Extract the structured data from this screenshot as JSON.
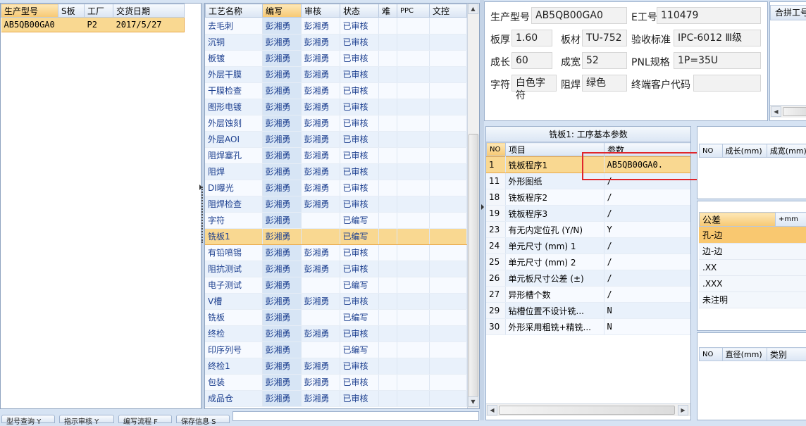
{
  "left_grid": {
    "headers": [
      "生产型号",
      "S板",
      "工厂",
      "交货日期"
    ],
    "rows": [
      {
        "model": "AB5QB00GA0",
        "s_board": "",
        "factory": "P2",
        "date": "2017/5/27"
      }
    ]
  },
  "process_grid": {
    "headers": [
      "工艺名称",
      "编写",
      "审核",
      "状态",
      "难",
      "PPC",
      "文控"
    ],
    "rows": [
      {
        "name": "去毛刺",
        "writer": "彭湘勇",
        "reviewer": "彭湘勇",
        "status": "已审核"
      },
      {
        "name": "沉铜",
        "writer": "彭湘勇",
        "reviewer": "彭湘勇",
        "status": "已审核"
      },
      {
        "name": "板镀",
        "writer": "彭湘勇",
        "reviewer": "彭湘勇",
        "status": "已审核"
      },
      {
        "name": "外层干膜",
        "writer": "彭湘勇",
        "reviewer": "彭湘勇",
        "status": "已审核"
      },
      {
        "name": "干膜检查",
        "writer": "彭湘勇",
        "reviewer": "彭湘勇",
        "status": "已审核"
      },
      {
        "name": "图形电镀",
        "writer": "彭湘勇",
        "reviewer": "彭湘勇",
        "status": "已审核"
      },
      {
        "name": "外层蚀刻",
        "writer": "彭湘勇",
        "reviewer": "彭湘勇",
        "status": "已审核"
      },
      {
        "name": "外层AOI",
        "writer": "彭湘勇",
        "reviewer": "彭湘勇",
        "status": "已审核"
      },
      {
        "name": "阻焊塞孔",
        "writer": "彭湘勇",
        "reviewer": "彭湘勇",
        "status": "已审核"
      },
      {
        "name": "阻焊",
        "writer": "彭湘勇",
        "reviewer": "彭湘勇",
        "status": "已审核"
      },
      {
        "name": "DI曝光",
        "writer": "彭湘勇",
        "reviewer": "彭湘勇",
        "status": "已审核"
      },
      {
        "name": "阻焊检查",
        "writer": "彭湘勇",
        "reviewer": "彭湘勇",
        "status": "已审核"
      },
      {
        "name": "字符",
        "writer": "彭湘勇",
        "reviewer": "",
        "status": "已编写"
      },
      {
        "name": "铣板1",
        "writer": "彭湘勇",
        "reviewer": "",
        "status": "已编写"
      },
      {
        "name": "有铅喷锡",
        "writer": "彭湘勇",
        "reviewer": "彭湘勇",
        "status": "已审核"
      },
      {
        "name": "阻抗测试",
        "writer": "彭湘勇",
        "reviewer": "彭湘勇",
        "status": "已审核"
      },
      {
        "name": "电子测试",
        "writer": "彭湘勇",
        "reviewer": "",
        "status": "已编写"
      },
      {
        "name": "V槽",
        "writer": "彭湘勇",
        "reviewer": "彭湘勇",
        "status": "已审核"
      },
      {
        "name": "铣板",
        "writer": "彭湘勇",
        "reviewer": "",
        "status": "已编写"
      },
      {
        "name": "终检",
        "writer": "彭湘勇",
        "reviewer": "彭湘勇",
        "status": "已审核"
      },
      {
        "name": "印序列号",
        "writer": "彭湘勇",
        "reviewer": "",
        "status": "已编写"
      },
      {
        "name": "终检1",
        "writer": "彭湘勇",
        "reviewer": "彭湘勇",
        "status": "已审核"
      },
      {
        "name": "包装",
        "writer": "彭湘勇",
        "reviewer": "彭湘勇",
        "status": "已审核"
      },
      {
        "name": "成品仓",
        "writer": "彭湘勇",
        "reviewer": "彭湘勇",
        "status": "已审核"
      }
    ],
    "active_row": 13
  },
  "info": {
    "model_label": "生产型号",
    "model_value": "AB5QB00GA0",
    "eno_label": "E工号",
    "eno_value": "110479",
    "thickness_label": "板厚",
    "thickness_value": "1.60",
    "material_label": "板材",
    "material_value": "TU-752",
    "standard_label": "验收标准",
    "standard_value": "IPC-6012 Ⅲ级",
    "length_label": "成长",
    "length_value": "60",
    "width_label": "成宽",
    "width_value": "52",
    "pnl_label": "PNL规格",
    "pnl_value": "1P=35U",
    "char_label": "字符",
    "char_value": "白色字符",
    "mask_label": "阻焊",
    "mask_value": "绿色",
    "customer_label": "终端客户代码",
    "customer_value": "",
    "combo_header": "合拼工号"
  },
  "params": {
    "title": "铣板1: 工序基本参数",
    "headers": [
      "NO",
      "项目",
      "参数"
    ],
    "rows": [
      {
        "no": "1",
        "item": "铣板程序1",
        "value": "AB5QB00GA0."
      },
      {
        "no": "11",
        "item": "外形图纸",
        "value": "/"
      },
      {
        "no": "18",
        "item": "铣板程序2",
        "value": "/"
      },
      {
        "no": "19",
        "item": "铣板程序3",
        "value": "/"
      },
      {
        "no": "23",
        "item": "有无内定位孔 (Y/N)",
        "value": "Y"
      },
      {
        "no": "24",
        "item": "单元尺寸 (mm) 1",
        "value": "/"
      },
      {
        "no": "25",
        "item": "单元尺寸 (mm) 2",
        "value": "/"
      },
      {
        "no": "26",
        "item": "单元板尺寸公差 (±)",
        "value": "/"
      },
      {
        "no": "27",
        "item": "异形槽个数",
        "value": "/"
      },
      {
        "no": "29",
        "item": "钻槽位置不设计铣...",
        "value": "N"
      },
      {
        "no": "30",
        "item": "外形采用粗铣+精铣...",
        "value": "N"
      }
    ]
  },
  "size_table": {
    "headers": [
      "NO",
      "成长(mm)",
      "成宽(mm)"
    ]
  },
  "tolerance": {
    "header": "公差",
    "plus_header": "+mm",
    "rows": [
      "孔-边",
      "边-边",
      ".XX",
      ".XXX",
      "未注明"
    ]
  },
  "hole_table": {
    "headers": [
      "NO",
      "直径(mm)",
      "类别"
    ]
  },
  "bottom_tabs": [
    "型号查询 Y",
    "指示审核 Y",
    "编写流程 F",
    "保存信息 S"
  ],
  "colors": {
    "accent": "#f9d891",
    "link_text": "#1c3f8f",
    "highlight_box": "#e0262b"
  }
}
